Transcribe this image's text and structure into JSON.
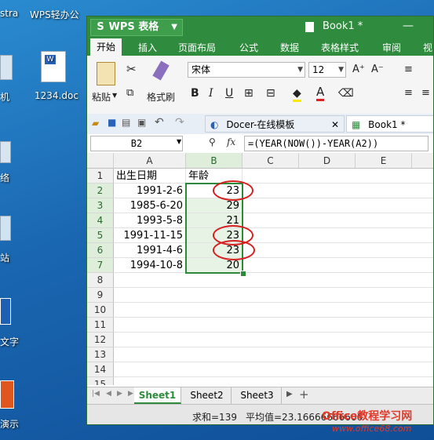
{
  "desktop": {
    "icons": [
      {
        "label": "stra",
        "icon": "app-icon"
      },
      {
        "label": "WPS轻办公",
        "icon": "wps-office-icon"
      },
      {
        "label": "机",
        "icon": "computer-icon"
      },
      {
        "label": "1234.doc",
        "icon": "word-document-icon"
      },
      {
        "label": "络",
        "icon": "network-icon"
      },
      {
        "label": "站",
        "icon": "recycle-bin-icon"
      },
      {
        "label": "文字",
        "icon": "wps-writer-icon"
      },
      {
        "label": "演示",
        "icon": "wps-presentation-icon"
      }
    ]
  },
  "window": {
    "app_button": "WPS 表格",
    "title": "Book1 *",
    "ribbon_tabs": [
      "开始",
      "插入",
      "页面布局",
      "公式",
      "数据",
      "表格样式",
      "审阅",
      "视"
    ],
    "active_tab": "开始",
    "paste_label": "粘贴",
    "format_painter_label": "格式刷",
    "font_name": "宋体",
    "font_size": "12",
    "bold": "B",
    "italic": "I",
    "underline": "U",
    "font_color_glyph": "A",
    "font_grow": "A⁺",
    "font_shrink": "A⁻",
    "doc_tabs": [
      "Docer-在线模板",
      "Book1 *"
    ],
    "name_box": "B2",
    "fx": "fx",
    "formula": "=(YEAR(NOW())-YEAR(A2))"
  },
  "sheet": {
    "columns": [
      "A",
      "B",
      "C",
      "D",
      "E"
    ],
    "selected_column": "B",
    "row_numbers": [
      "1",
      "2",
      "3",
      "4",
      "5",
      "6",
      "7",
      "8",
      "9",
      "10",
      "11",
      "12",
      "13",
      "14",
      "15"
    ],
    "headers": {
      "A": "出生日期",
      "B": "年龄"
    },
    "rows": [
      {
        "a": "1991-2-6",
        "b": "23"
      },
      {
        "a": "1985-6-20",
        "b": "29"
      },
      {
        "a": "1993-5-8",
        "b": "21"
      },
      {
        "a": "1991-11-15",
        "b": "23"
      },
      {
        "a": "1991-4-6",
        "b": "23"
      },
      {
        "a": "1994-10-8",
        "b": "20"
      }
    ]
  },
  "sheet_tabs": [
    "Sheet1",
    "Sheet2",
    "Sheet3"
  ],
  "active_sheet": "Sheet1",
  "nav_arrows": [
    "|◀",
    "◀",
    "▶",
    "▶|"
  ],
  "add_sheet": "+",
  "status": {
    "sum": "求和=139",
    "average": "平均值=23.16666666666"
  },
  "watermark": {
    "line1": "Office教程学习网",
    "line2": "www.office68.com"
  },
  "colors": {
    "accent": "#2f8b3d",
    "annotation": "#d62020"
  }
}
